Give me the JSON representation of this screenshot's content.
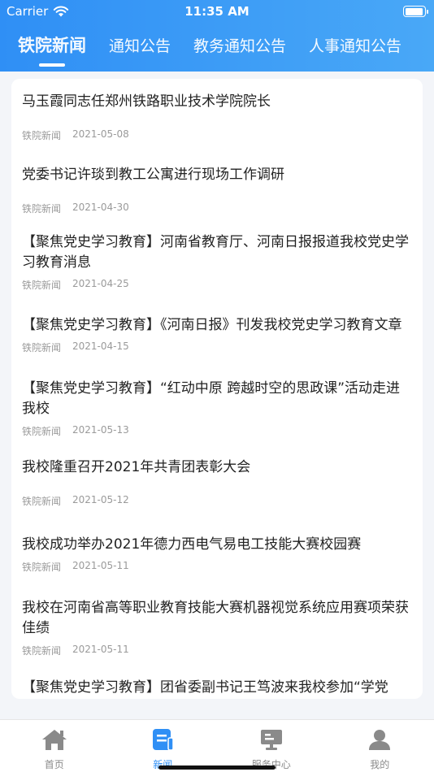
{
  "status_bar": {
    "carrier": "Carrier",
    "time": "11:35 AM",
    "battery_level": 0.95
  },
  "tabs": [
    {
      "label": "铁院新闻",
      "active": true
    },
    {
      "label": "通知公告",
      "active": false
    },
    {
      "label": "教务通知公告",
      "active": false
    },
    {
      "label": "人事通知公告",
      "active": false
    }
  ],
  "news": [
    {
      "title": "马玉霞同志任郑州铁路职业技术学院院长",
      "source": "铁院新闻",
      "date": "2021-05-08"
    },
    {
      "title": "党委书记许琰到教工公寓进行现场工作调研",
      "source": "铁院新闻",
      "date": "2021-04-30"
    },
    {
      "title": "【聚焦党史学习教育】河南省教育厅、河南日报报道我校党史学习教育消息",
      "source": "铁院新闻",
      "date": "2021-04-25"
    },
    {
      "title": "【聚焦党史学习教育】《河南日报》刊发我校党史学习教育文章",
      "source": "铁院新闻",
      "date": "2021-04-15"
    },
    {
      "title": "【聚焦党史学习教育】“红动中原 跨越时空的思政课”活动走进我校",
      "source": "铁院新闻",
      "date": "2021-05-13"
    },
    {
      "title": "我校隆重召开2021年共青团表彰大会",
      "source": "铁院新闻",
      "date": "2021-05-12"
    },
    {
      "title": "我校成功举办2021年德力西电气易电工技能大赛校园赛",
      "source": "铁院新闻",
      "date": "2021-05-11"
    },
    {
      "title": "我校在河南省高等职业教育技能大赛机器视觉系统应用赛项荣获佳绩",
      "source": "铁院新闻",
      "date": "2021-05-11"
    },
    {
      "title": "【聚焦党史学习教育】团省委副书记王笃波来我校参加“学党史，强信念，跟党走”主题团日活动",
      "source": "",
      "date": ""
    }
  ],
  "tabbar": [
    {
      "label": "首页",
      "icon": "home-icon",
      "active": false
    },
    {
      "label": "新闻",
      "icon": "news-icon",
      "active": true
    },
    {
      "label": "服务中心",
      "icon": "service-center-icon",
      "active": false
    },
    {
      "label": "我的",
      "icon": "profile-icon",
      "active": false
    }
  ],
  "colors": {
    "accent": "#2f8ff5",
    "inactive_icon": "#8a8a8a"
  }
}
